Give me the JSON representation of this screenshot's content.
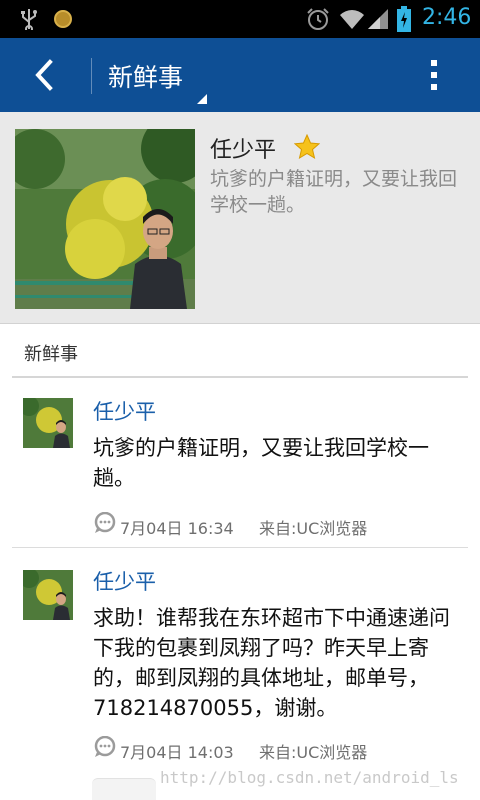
{
  "status_bar": {
    "time": "2:46",
    "icons": [
      "usb-icon",
      "coin-icon",
      "alarm-icon",
      "wifi-icon",
      "signal-icon",
      "battery-icon"
    ],
    "time_color": "#33b5e5"
  },
  "action_bar": {
    "title": "新鲜事",
    "icons": [
      "back-icon",
      "overflow-menu-icon"
    ],
    "color": "#0e4f95"
  },
  "profile": {
    "name": "任少平",
    "status": "坑爹的户籍证明，又要让我回学校一趟。",
    "icons": [
      "star-icon"
    ]
  },
  "section": {
    "title": "新鲜事"
  },
  "feed": [
    {
      "author": "任少平",
      "text": "坑爹的户籍证明，又要让我回学校一趟。",
      "time": "7月04日 16:34",
      "source": "来自:UC浏览器"
    },
    {
      "author": "任少平",
      "text": "求助！谁帮我在东环超市下中通速递问下我的包裹到凤翔了吗？昨天早上寄的，邮到凤翔的具体地址，邮单号，718214870055，谢谢。",
      "time": "7月04日 14:03",
      "source": "来自:UC浏览器"
    }
  ],
  "watermark": "http://blog.csdn.net/android_ls"
}
